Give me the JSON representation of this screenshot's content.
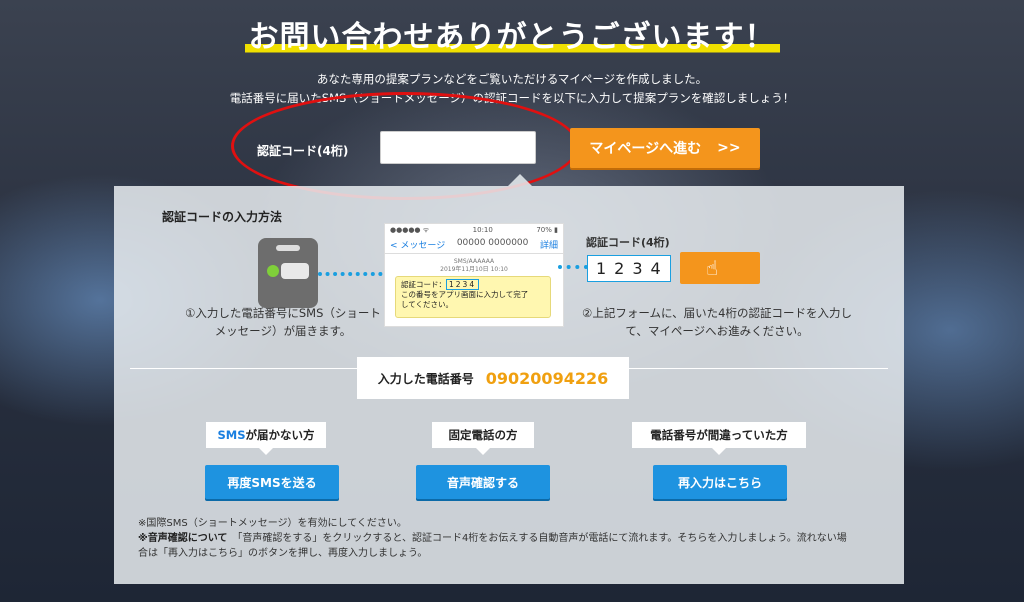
{
  "header": {
    "title": "お問い合わせありがとうございます！",
    "subtitle_line1": "あなた専用の提案プランなどをご覧いただけるマイページを作成しました。",
    "subtitle_line2": "電話番号に届いたSMS（ショートメッセージ）の認証コードを以下に入力して提案プランを確認しましょう！"
  },
  "auth_form": {
    "label": "認証コード(4桁)",
    "input_value": "",
    "submit_label": "マイページへ進む",
    "submit_arrow": ">>"
  },
  "howto": {
    "title": "認証コードの入力方法",
    "step1_line1": "①入力した電話番号にSMS（ショート",
    "step1_line2": "メッセージ）が届きます。",
    "mock": {
      "status_left": "●●●●● ᯤ",
      "status_time": "10:10",
      "status_right": "70% ▮",
      "nav_back": "< メッセージ",
      "nav_number": "00000 0000000",
      "nav_detail": "詳細",
      "sender_name": "SMS/AAAAAA",
      "sender_time": "2019年11月10日 10:10",
      "message_prefix": "認証コード：",
      "message_code": "1234",
      "message_line2": "この番号をアプリ画面に入力して完了",
      "message_line3": "してください。"
    },
    "example_label": "認証コード(4桁)",
    "example_code": "1234",
    "step2_line1": "②上記フォームに、届いた4桁の認証コードを入力し",
    "step2_line2": "て、マイページへお進みください。"
  },
  "phone": {
    "label": "入力した電話番号",
    "number": "09020094226"
  },
  "options": [
    {
      "tag_prefix": "SMS",
      "tag_suffix": "が届かない方",
      "button": "再度SMSを送る"
    },
    {
      "tag_prefix": "固定電話",
      "tag_suffix": "の方",
      "button": "音声確認する"
    },
    {
      "tag_prefix": "電話番号",
      "tag_suffix": "が間違っていた方",
      "button": "再入力はこちら"
    }
  ],
  "notes": {
    "line1": "※国際SMS（ショートメッセージ）を有効にしてください。",
    "line2_bold": "※音声確認について",
    "line2_rest": "　「音声確認をする」をクリックすると、認証コード4桁をお伝えする自動音声が電話にて流れます。そちらを入力しましょう。流れない場",
    "line3": "合は「再入力はこちら」のボタンを押し、再度入力しましょう。"
  },
  "colors": {
    "accent_orange": "#f4951c",
    "button_blue": "#1e93e0",
    "phone_number": "#f0a010",
    "highlight_ellipse": "#e01010",
    "title_underline": "#f0e000"
  }
}
